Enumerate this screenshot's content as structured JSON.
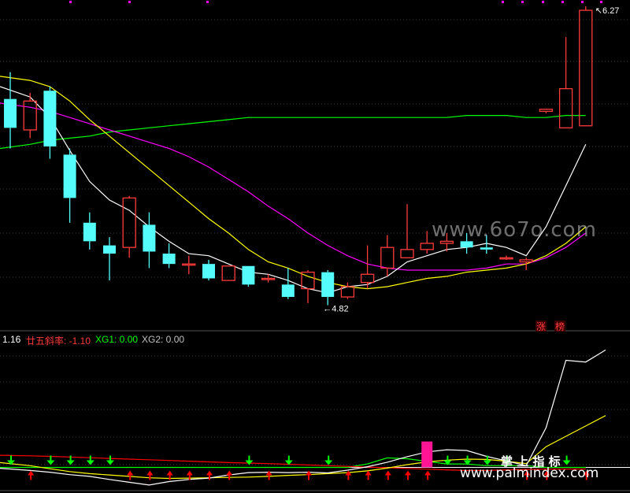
{
  "indicator": {
    "prefix": "1.16",
    "slope": "廿五斜率: -1.10",
    "xg1": "XG1: 0.00",
    "xg2": "XG2: 0.00"
  },
  "watermark": {
    "mid": "www.6o7o.com",
    "brand": "掌 上 指 标",
    "url": "www.palmindex.com"
  },
  "badges": [
    "涨",
    "榜"
  ],
  "colors": {
    "up": "#ff3b3b",
    "down": "#54fcfc",
    "ma5": "#ffffff",
    "ma10": "#ffff00",
    "ma20": "#ff00ff",
    "ma60": "#00ff00",
    "arrow_down": "#00ff00",
    "arrow_up": "#ff0000"
  },
  "chart_data": {
    "type": "candlestick",
    "price_annotations": {
      "high": "6.27",
      "low": "4.82"
    },
    "candles": [
      {
        "o": 5.82,
        "h": 5.95,
        "l": 5.58,
        "c": 5.68
      },
      {
        "o": 5.67,
        "h": 5.85,
        "l": 5.63,
        "c": 5.81
      },
      {
        "o": 5.86,
        "h": 5.88,
        "l": 5.53,
        "c": 5.59
      },
      {
        "o": 5.55,
        "h": 5.58,
        "l": 5.22,
        "c": 5.34
      },
      {
        "o": 5.22,
        "h": 5.27,
        "l": 5.09,
        "c": 5.13
      },
      {
        "o": 5.11,
        "h": 5.15,
        "l": 4.94,
        "c": 5.07
      },
      {
        "o": 5.1,
        "h": 5.35,
        "l": 5.05,
        "c": 5.34
      },
      {
        "o": 5.21,
        "h": 5.27,
        "l": 5.0,
        "c": 5.08
      },
      {
        "o": 5.07,
        "h": 5.12,
        "l": 5.0,
        "c": 5.02
      },
      {
        "o": 5.02,
        "h": 5.06,
        "l": 4.97,
        "c": 5.02
      },
      {
        "o": 5.02,
        "h": 5.04,
        "l": 4.94,
        "c": 4.95
      },
      {
        "o": 4.94,
        "h": 5.01,
        "l": 4.94,
        "c": 5.01
      },
      {
        "o": 5.01,
        "h": 5.01,
        "l": 4.91,
        "c": 4.92
      },
      {
        "o": 4.95,
        "h": 4.97,
        "l": 4.93,
        "c": 4.95
      },
      {
        "o": 4.92,
        "h": 5.0,
        "l": 4.85,
        "c": 4.86
      },
      {
        "o": 4.9,
        "h": 4.99,
        "l": 4.83,
        "c": 4.98
      },
      {
        "o": 4.98,
        "h": 4.99,
        "l": 4.82,
        "c": 4.86
      },
      {
        "o": 4.86,
        "h": 4.93,
        "l": 4.85,
        "c": 4.91
      },
      {
        "o": 4.93,
        "h": 5.11,
        "l": 4.9,
        "c": 4.97
      },
      {
        "o": 5.0,
        "h": 5.16,
        "l": 4.96,
        "c": 5.1
      },
      {
        "o": 5.05,
        "h": 5.31,
        "l": 5.05,
        "c": 5.09
      },
      {
        "o": 5.09,
        "h": 5.18,
        "l": 5.07,
        "c": 5.12
      },
      {
        "o": 5.12,
        "h": 5.17,
        "l": 5.08,
        "c": 5.13
      },
      {
        "o": 5.13,
        "h": 5.17,
        "l": 5.07,
        "c": 5.1
      },
      {
        "o": 5.1,
        "h": 5.16,
        "l": 5.07,
        "c": 5.09
      },
      {
        "o": 5.05,
        "h": 5.06,
        "l": 5.04,
        "c": 5.05
      },
      {
        "o": 5.03,
        "h": 5.05,
        "l": 4.99,
        "c": 5.04
      },
      {
        "o": 5.76,
        "h": 5.77,
        "l": 5.75,
        "c": 5.77
      },
      {
        "o": 5.68,
        "h": 6.12,
        "l": 5.68,
        "c": 5.87
      },
      {
        "o": 5.69,
        "h": 6.27,
        "l": 5.69,
        "c": 6.25
      }
    ],
    "ma5": [
      5.88,
      5.83,
      5.73,
      5.57,
      5.42,
      5.33,
      5.28,
      5.2,
      5.13,
      5.07,
      5.06,
      5.02,
      4.98,
      4.97,
      4.94,
      4.9,
      4.88,
      4.91,
      4.92,
      4.96,
      5.03,
      5.06,
      5.09,
      5.1,
      5.12,
      5.1,
      5.06,
      5.2,
      5.4,
      5.6
    ],
    "ma10": [
      5.93,
      5.91,
      5.88,
      5.81,
      5.72,
      5.64,
      5.56,
      5.48,
      5.4,
      5.32,
      5.24,
      5.17,
      5.09,
      5.03,
      5.0,
      4.96,
      4.93,
      4.91,
      4.9,
      4.91,
      4.93,
      4.95,
      4.96,
      4.98,
      4.99,
      5.0,
      5.02,
      5.06,
      5.12,
      5.2
    ],
    "ma20": [
      5.8,
      5.78,
      5.76,
      5.73,
      5.7,
      5.67,
      5.64,
      5.61,
      5.58,
      5.54,
      5.49,
      5.43,
      5.37,
      5.3,
      5.24,
      5.17,
      5.11,
      5.06,
      5.02,
      5.0,
      4.99,
      4.99,
      4.99,
      4.99,
      5.0,
      5.02,
      5.02,
      5.05,
      5.1,
      5.17
    ],
    "ma60": [
      5.58,
      5.6,
      5.62,
      5.63,
      5.64,
      5.66,
      5.67,
      5.68,
      5.69,
      5.7,
      5.71,
      5.72,
      5.73,
      5.73,
      5.73,
      5.73,
      5.73,
      5.73,
      5.73,
      5.73,
      5.73,
      5.73,
      5.73,
      5.74,
      5.74,
      5.74,
      5.73,
      5.73,
      5.74,
      5.74
    ],
    "ylim": [
      4.78,
      6.3
    ],
    "indicator": {
      "white": [
        -0.05,
        -0.18,
        -0.28,
        -0.42,
        -0.52,
        -0.7,
        -0.86,
        -1.02,
        -0.82,
        -0.7,
        -0.62,
        -0.44,
        -0.3,
        -0.28,
        -0.3,
        -0.28,
        -0.32,
        -0.16,
        0.04,
        0.3,
        0.62,
        0.9,
        1.02,
        0.98,
        0.64,
        0.38,
        0.1,
        2.3,
        6.2,
        6.1,
        6.8
      ],
      "yellow": [
        0.28,
        0.1,
        -0.08,
        -0.24,
        -0.36,
        -0.44,
        -0.52,
        -0.6,
        -0.64,
        -0.62,
        -0.6,
        -0.58,
        -0.56,
        -0.52,
        -0.46,
        -0.42,
        -0.36,
        -0.3,
        -0.2,
        -0.04,
        0.16,
        0.32,
        0.42,
        0.48,
        0.46,
        0.36,
        0.22,
        1.2,
        1.8,
        2.4,
        3.0
      ],
      "red_line": [
        0.7,
        0.67,
        0.64,
        0.6,
        0.56,
        0.52,
        0.48,
        0.44,
        0.4,
        0.36,
        0.32,
        0.28,
        0.25,
        0.22,
        0.18,
        0.14,
        0.1,
        0.06,
        0.02,
        -0.02,
        -0.06,
        -0.1,
        -0.14,
        -0.18,
        -0.18,
        -0.14,
        -0.12,
        -0.1,
        -0.1,
        -0.1
      ],
      "green_line": [
        0.0,
        0.0,
        0.0,
        0.0,
        0.0,
        0.0,
        0.0,
        0.0,
        0.0,
        0.0,
        0.0,
        0.0,
        0.0,
        0.0,
        0.0,
        0.0,
        0.0,
        0.0,
        0.2,
        0.55,
        0.5,
        0.35,
        0.2,
        0.2,
        0.1,
        0.1,
        0.1,
        0.0,
        0.0,
        0.0
      ],
      "down_arrows": [
        0,
        2,
        3,
        4,
        5,
        12,
        14,
        16,
        22,
        23,
        24,
        25,
        28
      ],
      "up_arrows": [
        1,
        6,
        7,
        8,
        9,
        10,
        11,
        13,
        15,
        17,
        18,
        19,
        20,
        21,
        26,
        27,
        29
      ],
      "magenta_bar": 21,
      "ylim": [
        -1.3,
        7.0
      ]
    }
  }
}
